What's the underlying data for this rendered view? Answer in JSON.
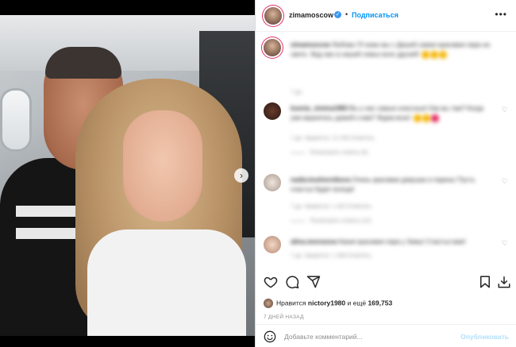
{
  "post": {
    "username": "zimamoscow",
    "follow_label": "Подписаться",
    "more_label": "•••",
    "verified_icon": "verified-badge-icon",
    "next_label": "›"
  },
  "comments": [
    {
      "author": "zimamoscow",
      "text": "Любовь! Я знаю мы с Дашей самая красивая пара на свете. Жду вас в нашей семье всех друзей!",
      "meta": "7 дн.",
      "reply": ""
    },
    {
      "author": "ksenia_zimina1983",
      "text": "Вы у нас самые классные! Как вы там? Когда уже вернетесь домой к нам? Ждем всех!",
      "meta": "7 дн.   Нравится: 12 293   Ответить",
      "reply": "Посмотреть ответы (6)"
    },
    {
      "author": "nadia.kozhevnikova",
      "text": "Очень красивая девушка и парень! Пусть счастье будет всегда!",
      "meta": "7 дн.   Нравится: 1 402   Ответить",
      "reply": "Посмотреть ответы (12)"
    },
    {
      "author": "alina.morozova",
      "text": "Какая красивая пара у Зимы! Счастья вам!",
      "meta": "7 дн.   Нравится: 1 308   Ответить",
      "reply": ""
    }
  ],
  "actions": {
    "like_icon": "heart-icon",
    "comment_icon": "comment-icon",
    "share_icon": "share-icon",
    "save_icon": "bookmark-icon",
    "download_icon": "download-icon"
  },
  "likes": {
    "prefix": "Нравится",
    "user": "nictory1980",
    "middle": "и ещё",
    "count": "169,753"
  },
  "timestamp": "7 ДНЕЙ НАЗАД",
  "comment_box": {
    "placeholder": "Добавьте комментарий...",
    "publish_label": "Опубликовать",
    "emoji_icon": "smile-icon"
  },
  "colors": {
    "accent": "#0095f6",
    "publish_disabled": "#b2dffc",
    "text": "#262626",
    "muted": "#8e8e8e"
  }
}
